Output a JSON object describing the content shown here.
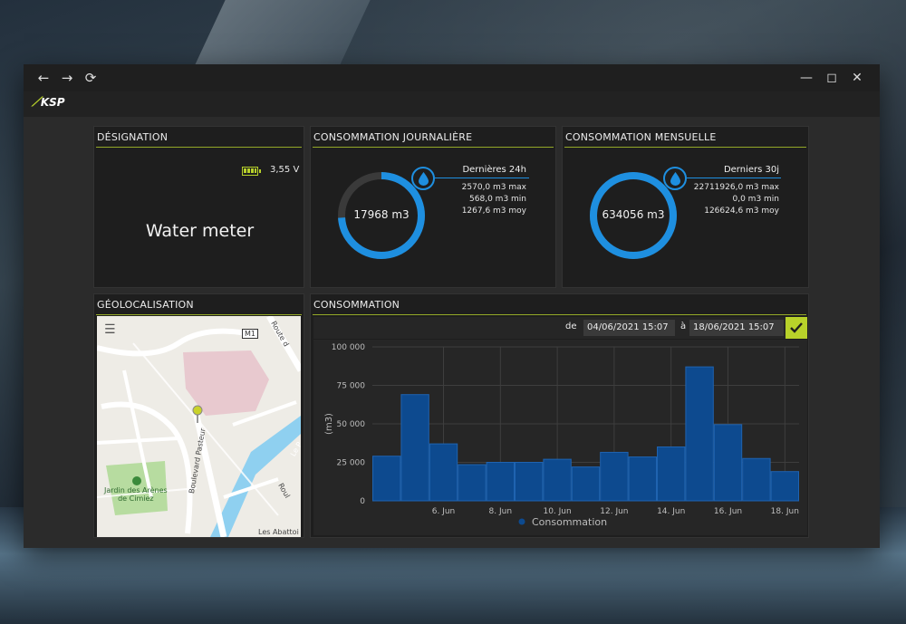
{
  "nav": {
    "back_icon": "←",
    "forward_icon": "→",
    "refresh_icon": "⟳"
  },
  "window_controls": {
    "minimize": "—",
    "maximize": "◻",
    "close": "✕"
  },
  "logo": {
    "text": "KSP",
    "accent": "#b8d22a"
  },
  "designation": {
    "title": "DÉSIGNATION",
    "voltage": "3,55 V",
    "device_name": "Water meter"
  },
  "daily": {
    "title": "CONSOMMATION JOURNALIÈRE",
    "value": "17968 m3",
    "fill": 0.74,
    "period": "Dernières 24h",
    "max": "2570,0 m3 max",
    "min": "568,0 m3 min",
    "avg": "1267,6 m3 moy"
  },
  "monthly": {
    "title": "CONSOMMATION MENSUELLE",
    "value": "634056 m3",
    "fill": 1.0,
    "period": "Derniers 30j",
    "max": "22711926,0 m3 max",
    "min": "0,0 m3 min",
    "avg": "126624,6 m3 moy"
  },
  "geo": {
    "title": "GÉOLOCALISATION",
    "labels": {
      "park": "Jardin des Arènes\nde Cimiez",
      "street1": "Boulevard Pasteur",
      "street2": "Les Abattoi",
      "road1": "Route d",
      "road2": "Le P",
      "road3": "Roul",
      "badge": "M1"
    }
  },
  "consommation": {
    "title": "CONSOMMATION",
    "from_label": "de",
    "from_value": "04/06/2021 15:07",
    "to_label": "à",
    "to_value": "18/06/2021 15:07"
  },
  "colors": {
    "accent": "#b8d22a",
    "gauge": "#1e8fe0",
    "bar": "#0d4a8f"
  },
  "chart_data": {
    "type": "bar",
    "x": [
      4,
      5,
      6,
      7,
      8,
      9,
      10,
      11,
      12,
      13,
      14,
      15,
      16,
      17,
      18
    ],
    "values": [
      29000,
      69000,
      37000,
      23500,
      25000,
      25000,
      27000,
      22000,
      31500,
      28500,
      35000,
      87000,
      49500,
      27500,
      19000
    ],
    "xticks": [
      "6. Jun",
      "8. Jun",
      "10. Jun",
      "12. Jun",
      "14. Jun",
      "16. Jun",
      "18. Jun"
    ],
    "xtick_positions": [
      6,
      8,
      10,
      12,
      14,
      16,
      18
    ],
    "yticks": [
      "0",
      "25 000",
      "50 000",
      "75 000",
      "100 000"
    ],
    "ylim": [
      0,
      100000
    ],
    "ylabel": "(m3)",
    "series": [
      {
        "name": "Consommation"
      }
    ],
    "legend": "bottom",
    "grid": true
  }
}
